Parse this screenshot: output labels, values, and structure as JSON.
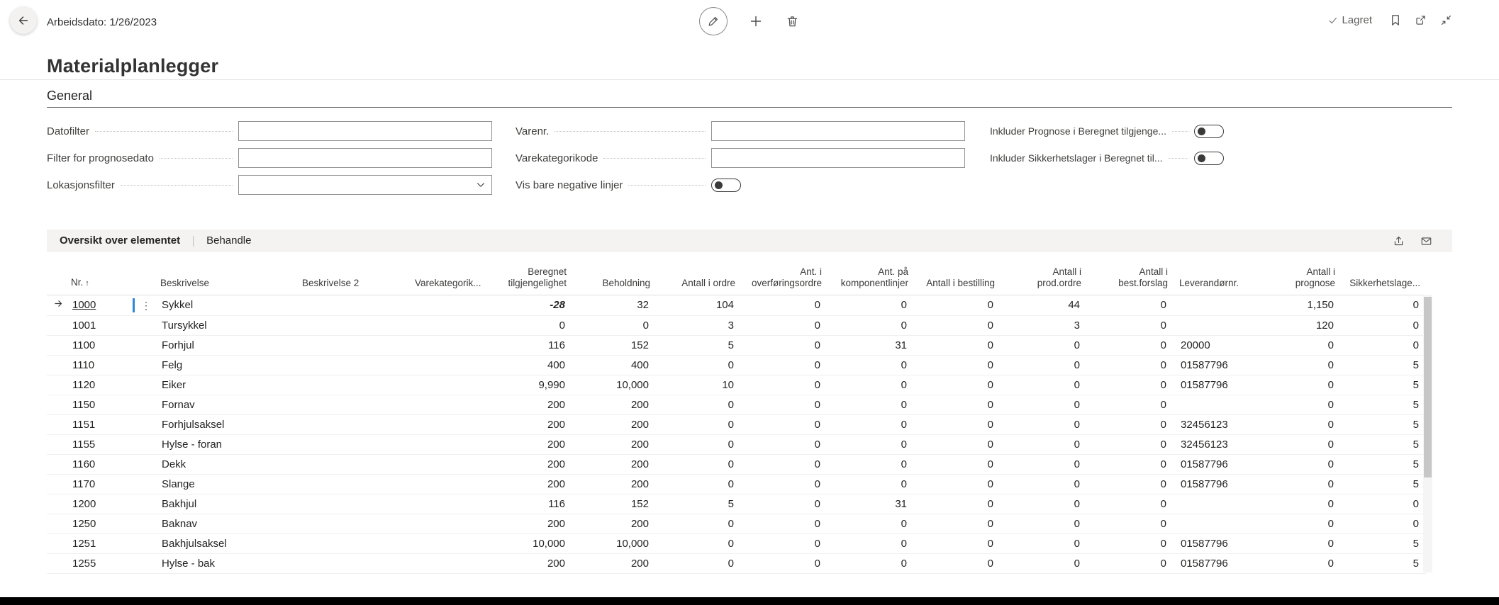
{
  "colors": {
    "link": "#2e74b5",
    "negative": "#a4262c",
    "accent": "#2b88d8"
  },
  "header": {
    "work_date": "Arbeidsdato: 1/26/2023",
    "title": "Materialplanlegger",
    "saved": "Lagret"
  },
  "general": {
    "section_title": "General",
    "datofilter_label": "Datofilter",
    "prognosedato_label": "Filter for prognosedato",
    "lokasjonsfilter_label": "Lokasjonsfilter",
    "varenr_label": "Varenr.",
    "varekategorikode_label": "Varekategorikode",
    "negative_label": "Vis bare negative linjer",
    "prognose_toggle_label": "Inkluder Prognose i Beregnet tilgjenge...",
    "sikkerhetslager_toggle_label": "Inkluder Sikkerhetslager i Beregnet til...",
    "values": {
      "datofilter": "",
      "prognosedato": "",
      "lokasjonsfilter": "",
      "varenr": "",
      "varekategorikode": ""
    },
    "toggles": {
      "negative": false,
      "prognose": false,
      "sikkerhetslager": false
    }
  },
  "grid": {
    "tab_overview": "Oversikt over elementet",
    "tab_manage": "Behandle",
    "columns": [
      {
        "key": "nr",
        "label": "Nr.",
        "align": "left",
        "type": "text",
        "sort": "asc"
      },
      {
        "key": "beskrivelse",
        "label": "Beskrivelse",
        "align": "left",
        "type": "text"
      },
      {
        "key": "beskrivelse2",
        "label": "Beskrivelse 2",
        "align": "left",
        "type": "text"
      },
      {
        "key": "varekategori",
        "label": "Varekategorik...",
        "align": "left",
        "type": "text"
      },
      {
        "key": "beregnet",
        "label": "Beregnet tilgjengelighet",
        "align": "right",
        "type": "number"
      },
      {
        "key": "beholdning",
        "label": "Beholdning",
        "align": "right",
        "type": "link"
      },
      {
        "key": "ordre",
        "label": "Antall i ordre",
        "align": "right",
        "type": "link"
      },
      {
        "key": "overforing",
        "label": "Ant. i overføringsordre",
        "align": "right",
        "type": "link"
      },
      {
        "key": "komponent",
        "label": "Ant. på komponentlinjer",
        "align": "right",
        "type": "link"
      },
      {
        "key": "bestilling",
        "label": "Antall i bestilling",
        "align": "right",
        "type": "link"
      },
      {
        "key": "prodordre",
        "label": "Antall i prod.ordre",
        "align": "right",
        "type": "link"
      },
      {
        "key": "bestforslag",
        "label": "Antall i best.forslag",
        "align": "right",
        "type": "link"
      },
      {
        "key": "leverandor",
        "label": "Leverandørnr.",
        "align": "left",
        "type": "text"
      },
      {
        "key": "prognose",
        "label": "Antall i prognose",
        "align": "right",
        "type": "link"
      },
      {
        "key": "sikkerhet",
        "label": "Sikkerhetslage...",
        "align": "right",
        "type": "number"
      }
    ],
    "rows": [
      {
        "selected": true,
        "nr": "1000",
        "beskrivelse": "Sykkel",
        "beskrivelse2": "",
        "varekategori": "",
        "beregnet": "-28",
        "beholdning": "32",
        "ordre": "104",
        "overforing": "0",
        "komponent": "0",
        "bestilling": "0",
        "prodordre": "44",
        "bestforslag": "0",
        "leverandor": "",
        "prognose": "1,150",
        "sikkerhet": "0"
      },
      {
        "nr": "1001",
        "beskrivelse": "Tursykkel",
        "beskrivelse2": "",
        "varekategori": "",
        "beregnet": "0",
        "beholdning": "0",
        "ordre": "3",
        "overforing": "0",
        "komponent": "0",
        "bestilling": "0",
        "prodordre": "3",
        "bestforslag": "0",
        "leverandor": "",
        "prognose": "120",
        "sikkerhet": "0"
      },
      {
        "nr": "1100",
        "beskrivelse": "Forhjul",
        "beskrivelse2": "",
        "varekategori": "",
        "beregnet": "116",
        "beholdning": "152",
        "ordre": "5",
        "overforing": "0",
        "komponent": "31",
        "bestilling": "0",
        "prodordre": "0",
        "bestforslag": "0",
        "leverandor": "20000",
        "prognose": "0",
        "sikkerhet": "0"
      },
      {
        "nr": "1110",
        "beskrivelse": "Felg",
        "beskrivelse2": "",
        "varekategori": "",
        "beregnet": "400",
        "beholdning": "400",
        "ordre": "0",
        "overforing": "0",
        "komponent": "0",
        "bestilling": "0",
        "prodordre": "0",
        "bestforslag": "0",
        "leverandor": "01587796",
        "prognose": "0",
        "sikkerhet": "5"
      },
      {
        "nr": "1120",
        "beskrivelse": "Eiker",
        "beskrivelse2": "",
        "varekategori": "",
        "beregnet": "9,990",
        "beholdning": "10,000",
        "ordre": "10",
        "overforing": "0",
        "komponent": "0",
        "bestilling": "0",
        "prodordre": "0",
        "bestforslag": "0",
        "leverandor": "01587796",
        "prognose": "0",
        "sikkerhet": "5"
      },
      {
        "nr": "1150",
        "beskrivelse": "Fornav",
        "beskrivelse2": "",
        "varekategori": "",
        "beregnet": "200",
        "beholdning": "200",
        "ordre": "0",
        "overforing": "0",
        "komponent": "0",
        "bestilling": "0",
        "prodordre": "0",
        "bestforslag": "0",
        "leverandor": "",
        "prognose": "0",
        "sikkerhet": "5"
      },
      {
        "nr": "1151",
        "beskrivelse": "Forhjulsaksel",
        "beskrivelse2": "",
        "varekategori": "",
        "beregnet": "200",
        "beholdning": "200",
        "ordre": "0",
        "overforing": "0",
        "komponent": "0",
        "bestilling": "0",
        "prodordre": "0",
        "bestforslag": "0",
        "leverandor": "32456123",
        "prognose": "0",
        "sikkerhet": "5"
      },
      {
        "nr": "1155",
        "beskrivelse": "Hylse - foran",
        "beskrivelse2": "",
        "varekategori": "",
        "beregnet": "200",
        "beholdning": "200",
        "ordre": "0",
        "overforing": "0",
        "komponent": "0",
        "bestilling": "0",
        "prodordre": "0",
        "bestforslag": "0",
        "leverandor": "32456123",
        "prognose": "0",
        "sikkerhet": "5"
      },
      {
        "nr": "1160",
        "beskrivelse": "Dekk",
        "beskrivelse2": "",
        "varekategori": "",
        "beregnet": "200",
        "beholdning": "200",
        "ordre": "0",
        "overforing": "0",
        "komponent": "0",
        "bestilling": "0",
        "prodordre": "0",
        "bestforslag": "0",
        "leverandor": "01587796",
        "prognose": "0",
        "sikkerhet": "5"
      },
      {
        "nr": "1170",
        "beskrivelse": "Slange",
        "beskrivelse2": "",
        "varekategori": "",
        "beregnet": "200",
        "beholdning": "200",
        "ordre": "0",
        "overforing": "0",
        "komponent": "0",
        "bestilling": "0",
        "prodordre": "0",
        "bestforslag": "0",
        "leverandor": "01587796",
        "prognose": "0",
        "sikkerhet": "5"
      },
      {
        "nr": "1200",
        "beskrivelse": "Bakhjul",
        "beskrivelse2": "",
        "varekategori": "",
        "beregnet": "116",
        "beholdning": "152",
        "ordre": "5",
        "overforing": "0",
        "komponent": "31",
        "bestilling": "0",
        "prodordre": "0",
        "bestforslag": "0",
        "leverandor": "",
        "prognose": "0",
        "sikkerhet": "0"
      },
      {
        "nr": "1250",
        "beskrivelse": "Baknav",
        "beskrivelse2": "",
        "varekategori": "",
        "beregnet": "200",
        "beholdning": "200",
        "ordre": "0",
        "overforing": "0",
        "komponent": "0",
        "bestilling": "0",
        "prodordre": "0",
        "bestforslag": "0",
        "leverandor": "",
        "prognose": "0",
        "sikkerhet": "0"
      },
      {
        "nr": "1251",
        "beskrivelse": "Bakhjulsaksel",
        "beskrivelse2": "",
        "varekategori": "",
        "beregnet": "10,000",
        "beholdning": "10,000",
        "ordre": "0",
        "overforing": "0",
        "komponent": "0",
        "bestilling": "0",
        "prodordre": "0",
        "bestforslag": "0",
        "leverandor": "01587796",
        "prognose": "0",
        "sikkerhet": "5"
      },
      {
        "nr": "1255",
        "beskrivelse": "Hylse - bak",
        "beskrivelse2": "",
        "varekategori": "",
        "beregnet": "200",
        "beholdning": "200",
        "ordre": "0",
        "overforing": "0",
        "komponent": "0",
        "bestilling": "0",
        "prodordre": "0",
        "bestforslag": "0",
        "leverandor": "01587796",
        "prognose": "0",
        "sikkerhet": "5"
      }
    ]
  },
  "icons": {
    "back": "arrow-left",
    "edit": "pencil",
    "new": "plus",
    "delete": "trash",
    "saved_check": "checkmark",
    "bookmark": "bookmark",
    "popout": "open-in-new-window",
    "collapse": "collapse-diagonal-arrows",
    "location_dropdown": "chevron-down",
    "share": "share-arrow",
    "mail": "envelope",
    "row_menu": "vertical-ellipsis",
    "selected_row": "arrow-right",
    "sort": "arrow-up"
  }
}
